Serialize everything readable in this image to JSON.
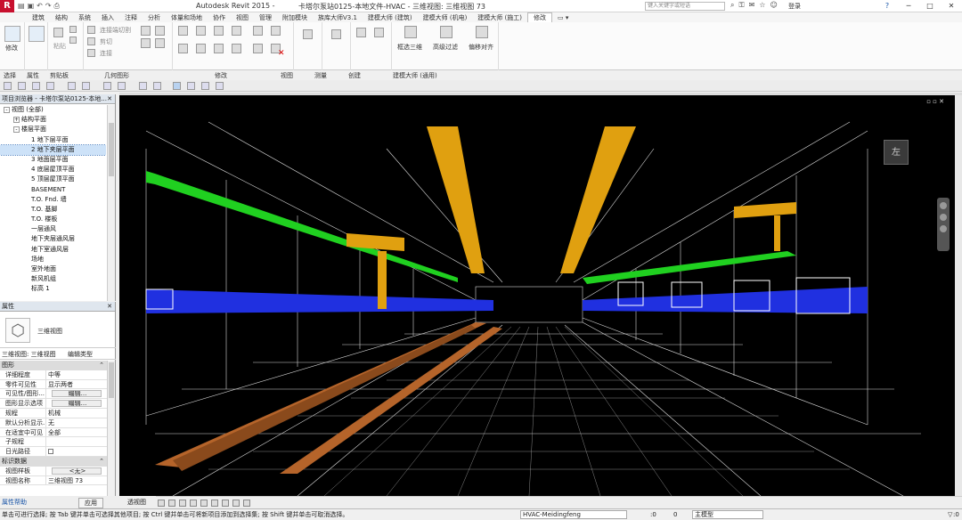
{
  "titlebar": {
    "app_title": "Autodesk Revit 2015 -",
    "file_title": "卡塔尔泵站0125-本地文件-HVAC - 三维视图: 三维视图 73",
    "search_placeholder": "键入关键字或短语",
    "login": "登录"
  },
  "ribbon_tabs": [
    "建筑",
    "结构",
    "系统",
    "插入",
    "注释",
    "分析",
    "体量和场地",
    "协作",
    "视图",
    "管理",
    "附加模块",
    "族库大师V3.1",
    "建模大师 (建筑)",
    "建模大师 (机电)",
    "建模大师 (施工)",
    "修改"
  ],
  "ribbon": {
    "modify": "修改",
    "panels": {
      "select": "选择",
      "properties": "属性",
      "clipboard": "剪贴板",
      "geometry": "几何图形",
      "modify": "修改",
      "view": "视图",
      "measure": "测量",
      "create": "创建",
      "master": "建模大师 (通用)"
    },
    "geometry_items": [
      "连接端切割",
      "剪切",
      "连接"
    ],
    "paste": "粘贴",
    "master_buttons": [
      "框选三维",
      "高级过滤",
      "偏移对齐"
    ]
  },
  "browser": {
    "title": "项目浏览器 - 卡塔尔泵站0125-本地...",
    "items": [
      {
        "text": "视图 (全部)",
        "level": 0,
        "exp": "-"
      },
      {
        "text": "结构平面",
        "level": 1,
        "exp": "+"
      },
      {
        "text": "楼层平面",
        "level": 1,
        "exp": "-"
      },
      {
        "text": "1 地下层平面",
        "level": 2,
        "exp": ""
      },
      {
        "text": "2 地下夹层平面",
        "level": 2,
        "exp": "",
        "selected": true
      },
      {
        "text": "3 地面层平面",
        "level": 2,
        "exp": ""
      },
      {
        "text": "4 底层屋顶平面",
        "level": 2,
        "exp": ""
      },
      {
        "text": "5 顶层屋顶平面",
        "level": 2,
        "exp": ""
      },
      {
        "text": "BASEMENT",
        "level": 2,
        "exp": ""
      },
      {
        "text": "T.O. Fnd. 墙",
        "level": 2,
        "exp": ""
      },
      {
        "text": "T.O. 基脚",
        "level": 2,
        "exp": ""
      },
      {
        "text": "T.O. 楼板",
        "level": 2,
        "exp": ""
      },
      {
        "text": "一层通风",
        "level": 2,
        "exp": ""
      },
      {
        "text": "地下夹层通风层",
        "level": 2,
        "exp": ""
      },
      {
        "text": "地下室通风层",
        "level": 2,
        "exp": ""
      },
      {
        "text": "场地",
        "level": 2,
        "exp": ""
      },
      {
        "text": "室外地面",
        "level": 2,
        "exp": ""
      },
      {
        "text": "新风机组",
        "level": 2,
        "exp": ""
      },
      {
        "text": "标高 1",
        "level": 2,
        "exp": ""
      }
    ]
  },
  "properties": {
    "title": "属性",
    "type_name": "三维视图",
    "type_selector": "三维视图: 三维视图",
    "edit_type": "编辑类型",
    "groups": [
      {
        "name": "图形",
        "rows": [
          {
            "k": "详细程度",
            "v": "中等"
          },
          {
            "k": "零件可见性",
            "v": "显示两者"
          },
          {
            "k": "可见性/图形...",
            "v": "编辑...",
            "btn": true
          },
          {
            "k": "图形显示选项",
            "v": "编辑...",
            "btn": true
          },
          {
            "k": "规程",
            "v": "机械"
          },
          {
            "k": "默认分析显示...",
            "v": "无"
          },
          {
            "k": "在适宜中可见",
            "v": "全部"
          },
          {
            "k": "子规程",
            "v": ""
          },
          {
            "k": "日光路径",
            "v": "",
            "check": true
          }
        ]
      },
      {
        "name": "标识数据",
        "rows": [
          {
            "k": "视图样板",
            "v": "<无>",
            "btn": true
          },
          {
            "k": "视图名称",
            "v": "三维视图 73"
          }
        ]
      }
    ],
    "help_link": "属性帮助",
    "apply": "应用"
  },
  "viewport": {
    "viewcube_face": "左",
    "view_mode_label": "透视图"
  },
  "status": {
    "message": "单击可进行选择; 按 Tab 键并单击可选择其他项目; 按 Ctrl 键并单击可将新项目添加到选择集; 按 Shift 键并单击可取消选择。",
    "workset": "HVAC-Meidingfeng",
    "zero1": ":0",
    "zero2": "0",
    "model": "主模型",
    "zero3": ":0"
  },
  "colors": {
    "duct_orange": "#e0a010",
    "duct_green": "#20d020",
    "duct_blue": "#2030e0",
    "pipe_brown": "#b5642a",
    "wire_white": "#e8e8e8",
    "accent_blue": "#1b56a8"
  }
}
